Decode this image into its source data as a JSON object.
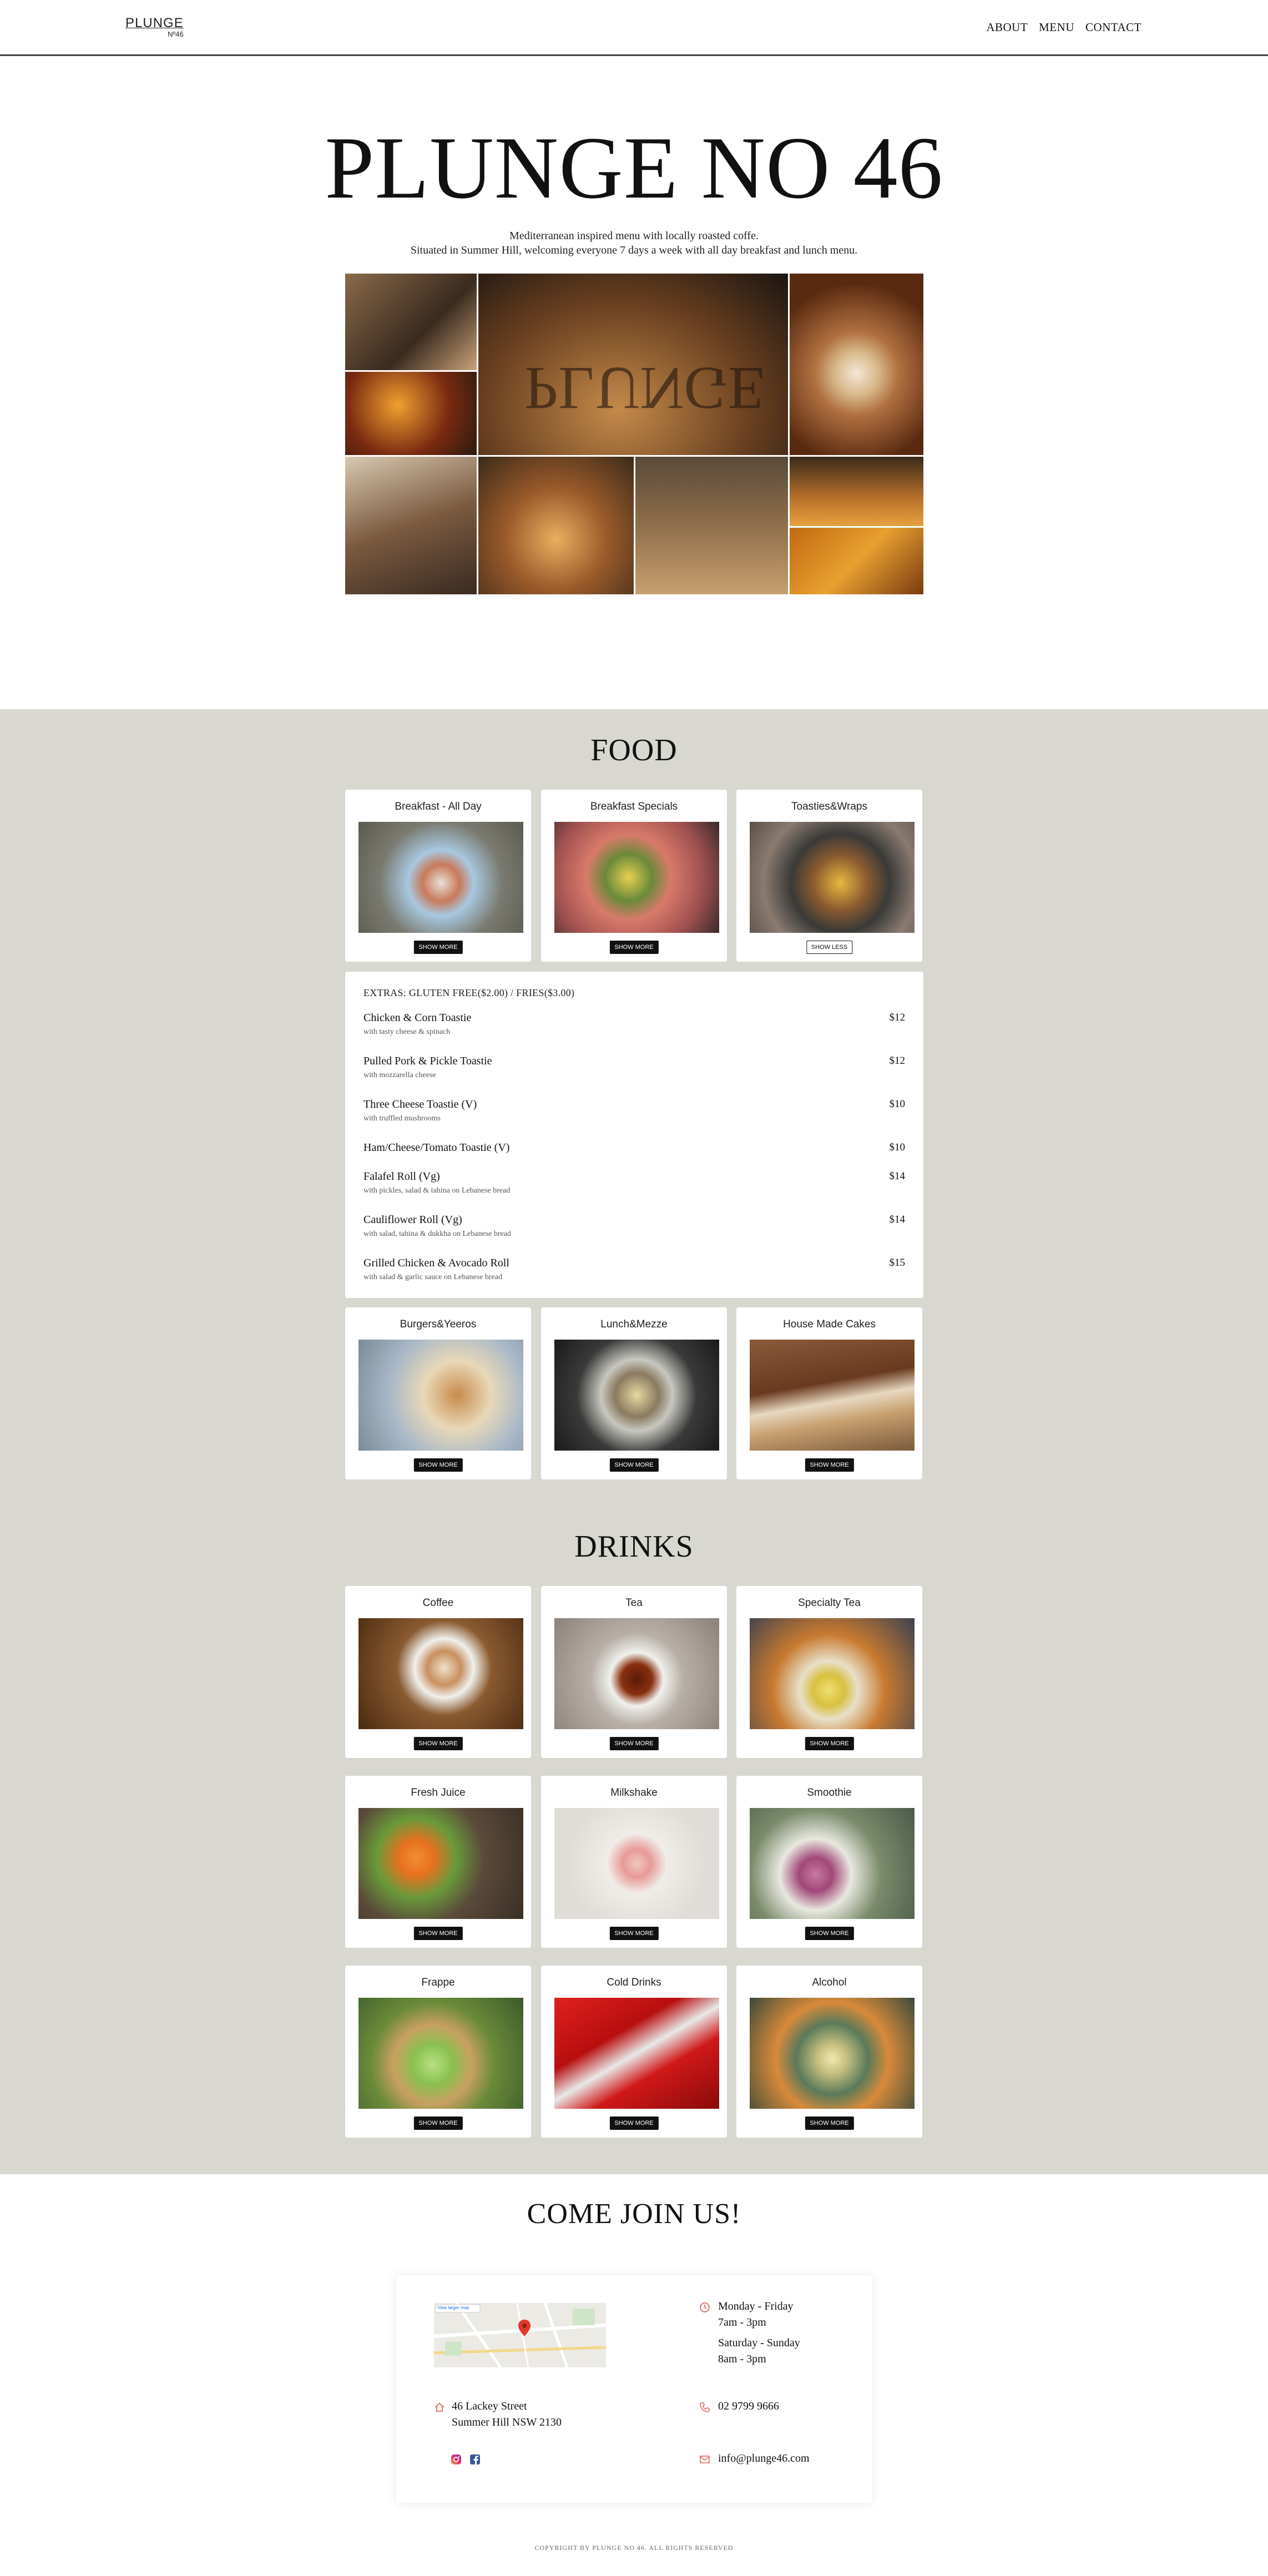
{
  "nav": {
    "logo_line1": "PLUNGE",
    "logo_line2": "Nº46",
    "links": [
      "ABOUT",
      "MENU",
      "CONTACT"
    ]
  },
  "hero": {
    "title": "PLUNGE NO 46",
    "tagline1": "Mediterranean inspired menu with locally roasted coffe.",
    "tagline2": "Situated in Summer Hill, welcoming everyone 7 days a week with all day breakfast and lunch menu."
  },
  "food": {
    "title": "FOOD",
    "cards_row1": [
      {
        "title": "Breakfast - All Day",
        "button": "SHOW MORE"
      },
      {
        "title": "Breakfast Specials",
        "button": "SHOW MORE"
      },
      {
        "title": "Toasties&Wraps",
        "button": "SHOW LESS"
      }
    ],
    "list": {
      "extras": "EXTRAS: GLUTEN FREE($2.00) / FRIES($3.00)",
      "items": [
        {
          "name": "Chicken & Corn Toastie",
          "desc": "with tasty cheese & spinach",
          "price": "$12"
        },
        {
          "name": "Pulled Pork & Pickle Toastie",
          "desc": "with mozzarella cheese",
          "price": "$12"
        },
        {
          "name": "Three Cheese Toastie (V)",
          "desc": "with truffled mushrooms",
          "price": "$10"
        },
        {
          "name": "Ham/Cheese/Tomato Toastie (V)",
          "desc": "",
          "price": "$10"
        },
        {
          "name": "Falafel Roll (Vg)",
          "desc": "with pickles, salad & tahina on Lebanese bread",
          "price": "$14"
        },
        {
          "name": "Cauliflower Roll (Vg)",
          "desc": "with salad, tahina & dukkha on Lebanese bread",
          "price": "$14"
        },
        {
          "name": "Grilled Chicken & Avocado Roll",
          "desc": "with salad & garlic sauce on Lebanese bread",
          "price": "$15"
        }
      ]
    },
    "cards_row2": [
      {
        "title": "Burgers&Yeeros",
        "button": "SHOW MORE"
      },
      {
        "title": "Lunch&Mezze",
        "button": "SHOW MORE"
      },
      {
        "title": "House Made Cakes",
        "button": "SHOW MORE"
      }
    ]
  },
  "drinks": {
    "title": "DRINKS",
    "rows": [
      [
        {
          "title": "Coffee",
          "button": "SHOW MORE"
        },
        {
          "title": "Tea",
          "button": "SHOW MORE"
        },
        {
          "title": "Specialty Tea",
          "button": "SHOW MORE"
        }
      ],
      [
        {
          "title": "Fresh Juice",
          "button": "SHOW MORE"
        },
        {
          "title": "Milkshake",
          "button": "SHOW MORE"
        },
        {
          "title": "Smoothie",
          "button": "SHOW MORE"
        }
      ],
      [
        {
          "title": "Frappe",
          "button": "SHOW MORE"
        },
        {
          "title": "Cold Drinks",
          "button": "SHOW MORE"
        },
        {
          "title": "Alcohol",
          "button": "SHOW MORE"
        }
      ]
    ]
  },
  "join": {
    "title": "COME JOIN US!",
    "hours1_days": "Monday - Friday",
    "hours1_time": "7am - 3pm",
    "hours2_days": "Saturday - Sunday",
    "hours2_time": "8am - 3pm",
    "address1": "46 Lackey Street",
    "address2": "Summer Hill NSW 2130",
    "phone": "02 9799 9666",
    "email": "info@plunge46.com",
    "map_link": "View larger map"
  },
  "footer": {
    "copyright": "COPYRIGHT BY PLUNGE NO 46. ALL RIGHTS RESERVED"
  },
  "colors": {
    "menu_bg": "#d8d8d0",
    "accent_icon": "#e06a5a",
    "button": "#111111"
  },
  "icons": [
    "clock-icon",
    "home-icon",
    "phone-icon",
    "mail-icon",
    "instagram-icon",
    "facebook-icon",
    "map-pin-icon"
  ]
}
